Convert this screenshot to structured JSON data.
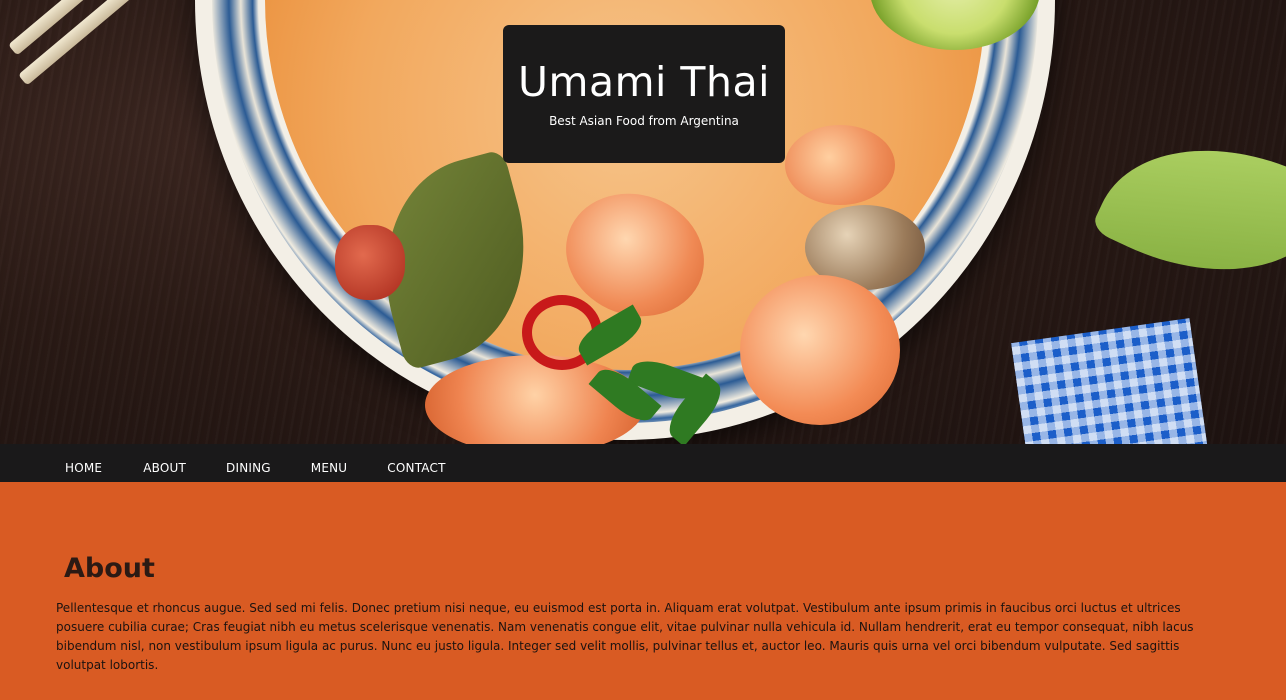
{
  "header": {
    "title": "Umami Thai",
    "tagline": "Best Asian Food from Argentina"
  },
  "nav": {
    "items": [
      {
        "label": "HOME"
      },
      {
        "label": "ABOUT"
      },
      {
        "label": "DINING"
      },
      {
        "label": "MENU"
      },
      {
        "label": "CONTACT"
      }
    ]
  },
  "about": {
    "heading": "About",
    "text": "Pellentesque et rhoncus augue. Sed sed mi felis. Donec pretium nisi neque, eu euismod est porta in. Aliquam erat volutpat. Vestibulum ante ipsum primis in faucibus orci luctus et ultrices posuere cubilia curae; Cras feugiat nibh eu metus scelerisque venenatis. Nam venenatis congue elit, vitae pulvinar nulla vehicula id. Nullam hendrerit, erat eu tempor consequat, nibh lacus bibendum nisl, non vestibulum ipsum ligula ac purus. Nunc eu justo ligula. Integer sed velit mollis, pulvinar tellus et, auctor leo. Mauris quis urna vel orci bibendum vulputate. Sed sagittis volutpat lobortis."
  },
  "colors": {
    "accent": "#d95b23",
    "nav_bg": "#1a191a",
    "title_box_bg": "#1b1a1a"
  }
}
